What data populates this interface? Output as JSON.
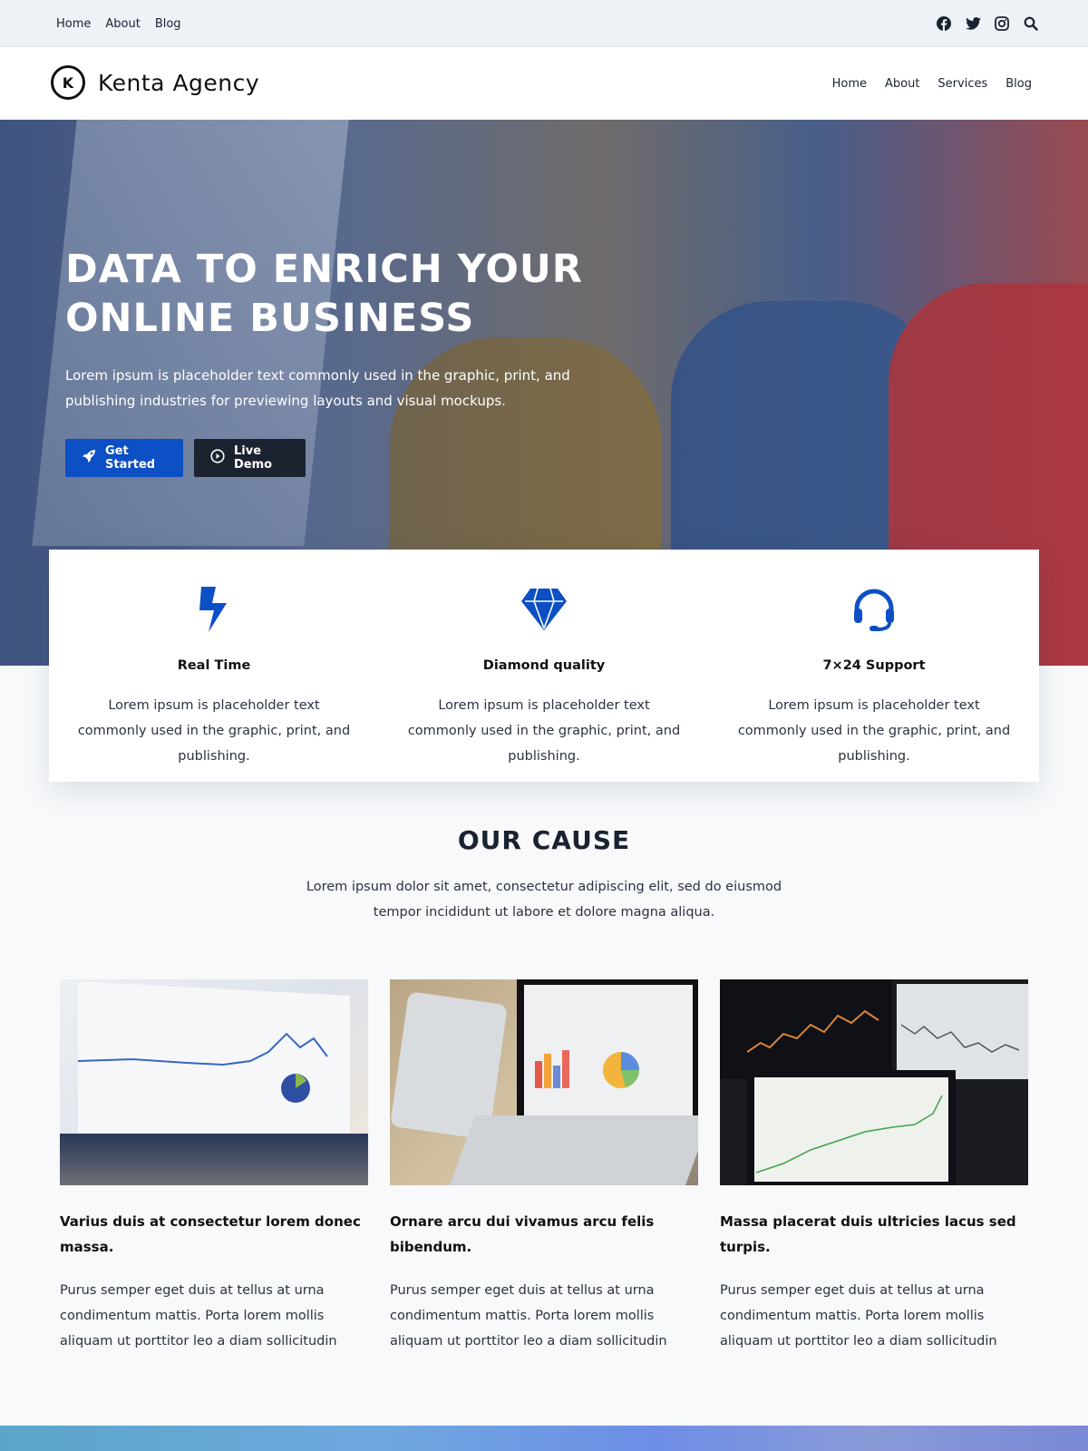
{
  "topbar": {
    "nav": [
      "Home",
      "About",
      "Blog"
    ],
    "social_icons": [
      "facebook-icon",
      "twitter-icon",
      "instagram-icon",
      "search-icon"
    ]
  },
  "header": {
    "logo_letter": "K",
    "site_name": "Kenta Agency",
    "nav": [
      "Home",
      "About",
      "Services",
      "Blog"
    ]
  },
  "hero": {
    "title": "DATA TO ENRICH YOUR ONLINE BUSINESS",
    "description": "Lorem ipsum is placeholder text commonly used in the graphic, print, and publishing industries for previewing layouts and visual mockups.",
    "primary_button": "Get Started",
    "secondary_button": "Live Demo",
    "primary_color": "#0d4fc4",
    "secondary_color": "#1b2230"
  },
  "features": [
    {
      "icon": "lightning-icon",
      "title": "Real Time",
      "text": "Lorem ipsum is placeholder text commonly used in the graphic, print, and publishing."
    },
    {
      "icon": "diamond-icon",
      "title": "Diamond quality",
      "text": "Lorem ipsum is placeholder text commonly used in the graphic, print, and publishing."
    },
    {
      "icon": "headset-icon",
      "title": "7×24 Support",
      "text": "Lorem ipsum is placeholder text commonly used in the graphic, print, and publishing."
    }
  ],
  "cause": {
    "title": "OUR CAUSE",
    "subtitle": "Lorem ipsum dolor sit amet, consectetur adipiscing elit, sed do eiusmod tempor incididunt ut labore et dolore magna aliqua."
  },
  "cards": [
    {
      "title": "Varius duis at consectetur lorem donec massa.",
      "text": "Purus semper eget duis at tellus at urna condimentum mattis. Porta lorem mollis aliquam ut porttitor leo a diam sollicitudin"
    },
    {
      "title": "Ornare arcu dui vivamus arcu felis bibendum.",
      "text": "Purus semper eget duis at tellus at urna condimentum mattis. Porta lorem mollis aliquam ut porttitor leo a diam sollicitudin"
    },
    {
      "title": "Massa placerat duis ultricies lacus sed turpis.",
      "text": "Purus semper eget duis at tellus at urna condimentum mattis. Porta lorem mollis aliquam ut porttitor leo a diam sollicitudin"
    }
  ],
  "colors": {
    "accent": "#0d4fc4",
    "dark": "#1b2230",
    "background": "#f7f9fb"
  }
}
